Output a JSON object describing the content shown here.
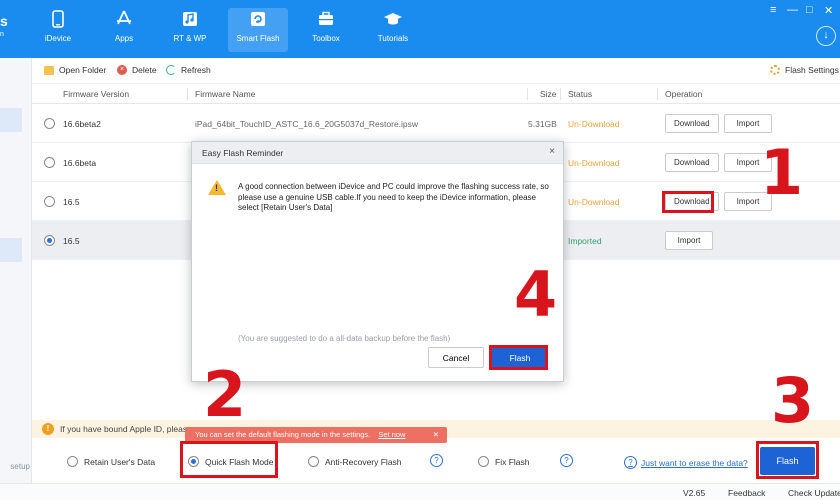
{
  "app": {
    "brand_letter": "s",
    "brand_sub": "n"
  },
  "nav": [
    {
      "label": "iDevice",
      "icon": "phone-icon"
    },
    {
      "label": "Apps",
      "icon": "appstore-icon"
    },
    {
      "label": "RT & WP",
      "icon": "music-icon"
    },
    {
      "label": "Smart Flash",
      "icon": "flash-icon",
      "active": true
    },
    {
      "label": "Toolbox",
      "icon": "toolbox-icon"
    },
    {
      "label": "Tutorials",
      "icon": "graduation-cap-icon"
    }
  ],
  "window_controls": {
    "menu": "≡",
    "minimize": "—",
    "maximize": "□",
    "close": "✕",
    "download": "↓"
  },
  "toolbar": {
    "open_folder": "Open Folder",
    "delete": "Delete",
    "refresh": "Refresh",
    "settings": "Flash Settings"
  },
  "table": {
    "headers": {
      "version": "Firmware Version",
      "name": "Firmware Name",
      "size": "Size",
      "status": "Status",
      "operation": "Operation"
    },
    "rows": [
      {
        "version": "16.6beta2",
        "name": "iPad_64bit_TouchID_ASTC_16.6_20G5037d_Restore.ipsw",
        "size": "5.31GB",
        "status": "Un-Download",
        "download": "Download",
        "import": "Import"
      },
      {
        "version": "16.6beta",
        "name": "",
        "size": "",
        "status": "Un-Download",
        "download": "Download",
        "import": "Import"
      },
      {
        "version": "16.5",
        "name": "",
        "size": "",
        "status": "Un-Download",
        "download": "Download",
        "import": "Import"
      },
      {
        "version": "16.5",
        "name": "",
        "size": "",
        "status": "Imported",
        "download": "",
        "import": "Import"
      }
    ]
  },
  "modal": {
    "title": "Easy Flash Reminder",
    "close": "×",
    "warning_symbol": "!",
    "message": "A good connection between iDevice and PC could improve the flashing success rate, so please use a genuine USB cable.If you need to keep the iDevice information, please select [Retain User's Data]",
    "hint": "(You are suggested to do a all-data backup before the flash)",
    "cancel": "Cancel",
    "flash": "Flash"
  },
  "notice": {
    "icon": "!",
    "text": "If you have bound Apple ID, please"
  },
  "tooltip": {
    "text": "You can set the default flashing mode in the settings.",
    "link": "Set now",
    "close": "✕"
  },
  "modes": {
    "retain": "Retain User's Data",
    "quick": "Quick Flash Mode",
    "anti": "Anti-Recovery Flash",
    "fix": "Fix Flash",
    "help": "?",
    "erase_link": "Just want to erase the data?",
    "flash": "Flash"
  },
  "sidebar": {
    "setup": "setup"
  },
  "statusbar": {
    "version": "V2.65",
    "feedback": "Feedback",
    "check_update": "Check Update"
  },
  "annotations": {
    "n1": "1",
    "n2": "2",
    "n3": "3",
    "n4": "4",
    "color": "#d8141c"
  },
  "colors": {
    "topbar": "#1a8cf0",
    "primary_button": "#1e63d6",
    "undownload": "#e8a33d",
    "imported": "#36a36a"
  }
}
